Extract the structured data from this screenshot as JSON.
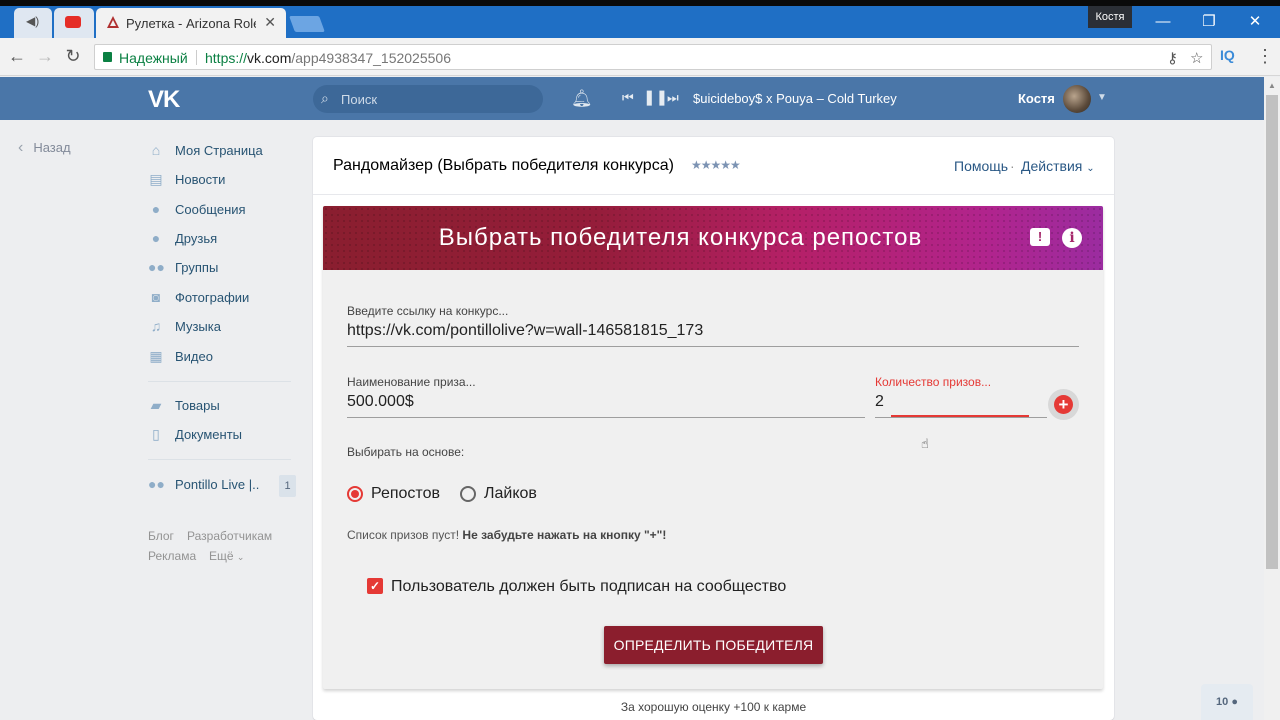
{
  "browser": {
    "tabs": [
      {
        "label": "",
        "icon": "speaker-icon"
      },
      {
        "label": "",
        "icon": "youtube-icon"
      },
      {
        "label": "Рулетка - Arizona RoleP",
        "icon": "arizona-icon"
      }
    ],
    "profile_name": "Костя",
    "secure_label": "Надежный",
    "url_scheme": "https://",
    "url_host": "vk.com",
    "url_path": "/app4938347_152025506",
    "iq_label": "IQ"
  },
  "vk_header": {
    "logo": "VK",
    "search_placeholder": "Поиск",
    "now_playing": "$uicideboy$ x Pouya – Cold Turkey",
    "user_name": "Костя"
  },
  "sidebar": {
    "back_label": "Назад",
    "items": [
      {
        "label": "Моя Страница",
        "icon": "home-icon"
      },
      {
        "label": "Новости",
        "icon": "news-icon"
      },
      {
        "label": "Сообщения",
        "icon": "messages-icon"
      },
      {
        "label": "Друзья",
        "icon": "friends-icon"
      },
      {
        "label": "Группы",
        "icon": "groups-icon"
      },
      {
        "label": "Фотографии",
        "icon": "camera-icon"
      },
      {
        "label": "Музыка",
        "icon": "music-icon"
      },
      {
        "label": "Видео",
        "icon": "video-icon"
      }
    ],
    "items2": [
      {
        "label": "Товары",
        "icon": "goods-icon"
      },
      {
        "label": "Документы",
        "icon": "documents-icon"
      }
    ],
    "community": {
      "label": "Pontillo Live |..",
      "badge": "1"
    },
    "footer": {
      "blog": "Блог",
      "developers": "Разработчикам",
      "ads": "Реклама",
      "more": "Ещё"
    }
  },
  "app": {
    "title": "Рандомайзер (Выбрать победителя конкурса)",
    "stars": "★★★★★",
    "help": "Помощь",
    "dot": "·",
    "actions": "Действия",
    "banner_title": "Выбрать победителя конкурса репостов",
    "info_glyph": "i",
    "feedback_glyph": "!",
    "contest_link_label": "Введите ссылку на конкурс...",
    "contest_link_value": "https://vk.com/pontillolive?w=wall-146581815_173",
    "prize_name_label": "Наименование приза...",
    "prize_name_value": "500.000$",
    "prize_count_label": "Количество призов...",
    "prize_count_value": "2",
    "add_glyph": "+",
    "basis_label": "Выбирать на основе:",
    "radio_reposts": "Репостов",
    "radio_likes": "Лайков",
    "hint_text": "Список призов пуст!",
    "hint_strong": "Не забудьте нажать на кнопку \"+\"!",
    "subscribe_label": "Пользователь должен быть подписан на сообщество",
    "check_glyph": "✓",
    "submit_label": "ОПРЕДЕЛИТЬ ПОБЕДИТЕЛЯ",
    "rate_text": "За хорошую оценку +100 к карме"
  },
  "online_count": "10",
  "colors": {
    "vk_blue": "#4a76a8",
    "accent_red": "#e53935",
    "button_maroon": "#8b1e2d"
  }
}
